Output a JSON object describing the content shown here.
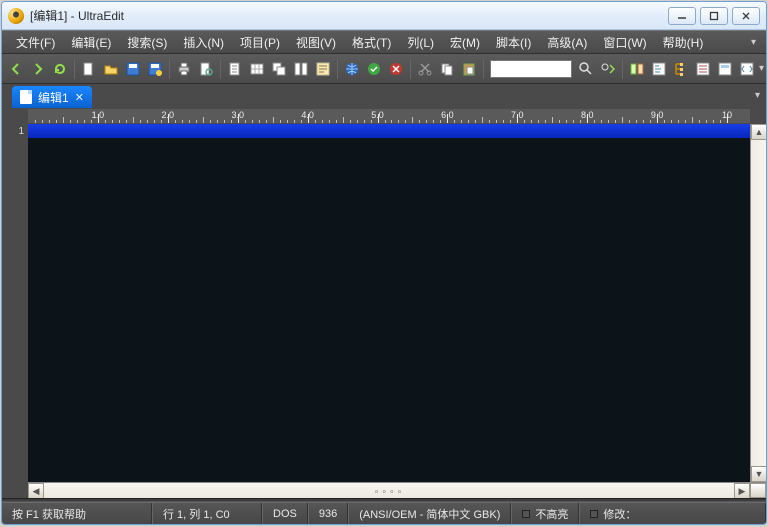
{
  "window": {
    "title": "[编辑1] - UltraEdit"
  },
  "menu": {
    "items": [
      "文件(F)",
      "编辑(E)",
      "搜索(S)",
      "插入(N)",
      "项目(P)",
      "视图(V)",
      "格式(T)",
      "列(L)",
      "宏(M)",
      "脚本(I)",
      "高级(A)",
      "窗口(W)",
      "帮助(H)"
    ]
  },
  "toolbar": {
    "icons": [
      "back-icon",
      "forward-icon",
      "refresh-icon",
      "new-file-icon",
      "open-file-icon",
      "save-icon",
      "save-as-icon",
      "print-icon",
      "print-preview-icon",
      "page-setup-icon",
      "toggle-hex-icon",
      "cascade-icon",
      "tile-icon",
      "word-wrap-icon",
      "web-browser-icon",
      "html-validate-icon",
      "html-tidy-icon",
      "cut-icon",
      "copy-icon",
      "paste-icon",
      "find-field",
      "find-icon",
      "find-next-icon",
      "sessions-icon",
      "function-list-icon",
      "file-tree-icon",
      "macro-list-icon",
      "template-list-icon",
      "tag-list-icon"
    ],
    "find_value": ""
  },
  "tab": {
    "label": "编辑1"
  },
  "ruler": {
    "labels": [
      "1.0",
      "2.0",
      "3.0",
      "4.0",
      "5.0",
      "6.0",
      "7.0",
      "8.0",
      "9.0",
      "10"
    ]
  },
  "gutter": {
    "line1": "1"
  },
  "status": {
    "help": "按 F1 获取帮助",
    "pos": "行 1, 列 1, C0",
    "eol": "DOS",
    "codepage": "936",
    "encoding": "(ANSI/OEM - 简体中文 GBK)",
    "highlight": "不高亮",
    "modified": "修改："
  }
}
